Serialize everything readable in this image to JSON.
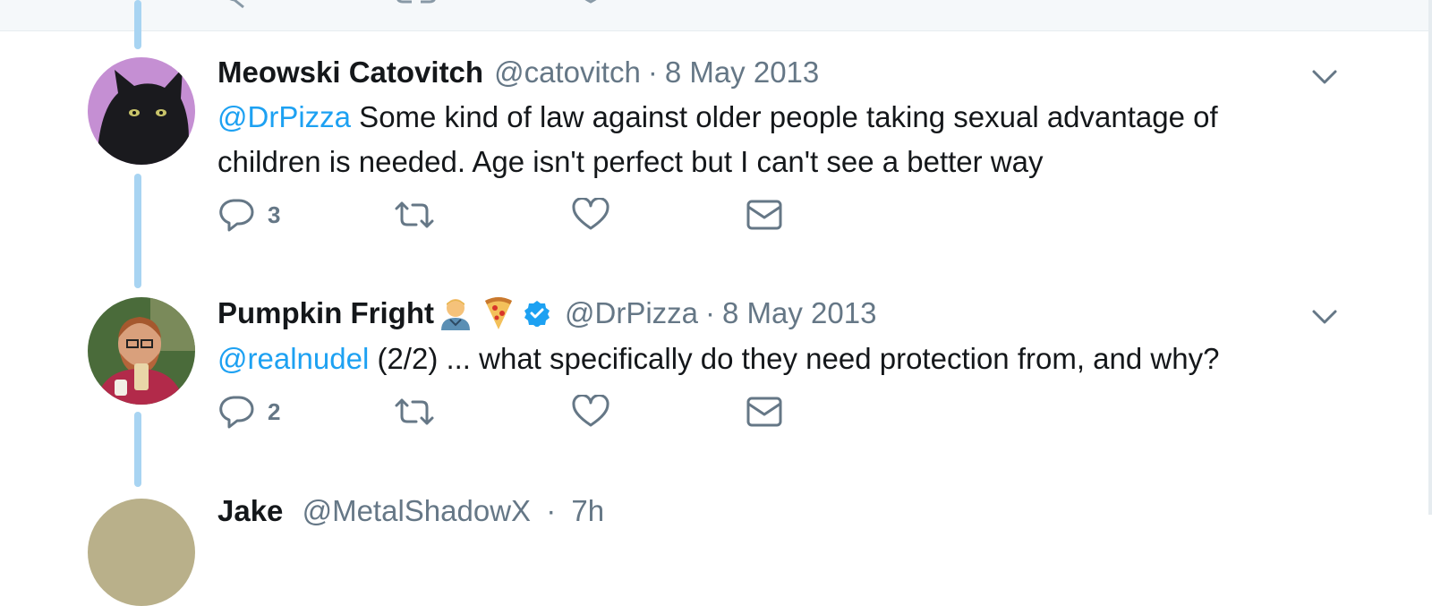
{
  "tweets": [
    {
      "name": "Meowski Catovitch",
      "handle": "@catovitch",
      "separator": "·",
      "date": "8 May 2013",
      "mention": "@DrPizza",
      "text": " Some kind of law against older people taking sexual advantage of children is needed. Age isn't perfect but I can't see a better way",
      "reply_count": "3"
    },
    {
      "name": "Pumpkin Fright",
      "name_emojis": [
        "man-health-worker-emoji",
        "pizza-emoji"
      ],
      "verified": true,
      "handle": "@DrPizza",
      "separator": "·",
      "date": "8 May 2013",
      "mention": "@realnudel",
      "text": " (2/2) ... what specifically do they need protection from, and why?",
      "reply_count": "2"
    }
  ],
  "partial_tweet": {
    "name": "Jake",
    "handle": "@MetalShadowX",
    "separator": "·",
    "date": "7h"
  },
  "colors": {
    "link": "#1da1f2",
    "muted": "#657786",
    "thread_line": "#a8d4f2",
    "verified": "#1da1f2"
  },
  "icons": [
    "reply-icon",
    "retweet-icon",
    "like-icon",
    "direct-message-icon",
    "chevron-down-icon",
    "verified-badge-icon"
  ]
}
